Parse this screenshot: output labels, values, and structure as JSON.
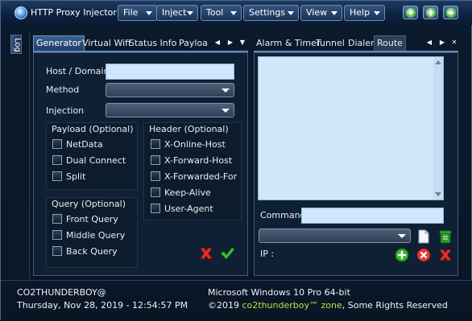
{
  "window": {
    "title": "HTTP Proxy Injector"
  },
  "menu": [
    {
      "label": "File"
    },
    {
      "label": "Inject"
    },
    {
      "label": "Tool"
    },
    {
      "label": "Settings"
    },
    {
      "label": "View"
    },
    {
      "label": "Help"
    }
  ],
  "window_buttons": {
    "icons": [
      "down-arrow-icon",
      "up-arrow-icon",
      "right-arrow-icon"
    ]
  },
  "side": {
    "log_label": "Log"
  },
  "left_tabs": {
    "items": [
      "Generator",
      "Virtual Wifi",
      "Status Info",
      "Payload"
    ],
    "active": "Generator"
  },
  "generator": {
    "host_label": "Host / Domain",
    "host_value": "",
    "method_label": "Method",
    "method_value": "",
    "injection_label": "Injection",
    "injection_value": "",
    "payload_group": {
      "title": "Payload (Optional)",
      "options": [
        "NetData",
        "Dual Connect",
        "Split"
      ]
    },
    "header_group": {
      "title": "Header (Optional)",
      "options": [
        "X-Online-Host",
        "X-Forward-Host",
        "X-Forwarded-For",
        "Keep-Alive",
        "User-Agent"
      ]
    },
    "query_group": {
      "title": "Query (Optional)",
      "options": [
        "Front Query",
        "Middle Query",
        "Back Query"
      ]
    }
  },
  "right_tabs": {
    "items": [
      "Alarm & Timer",
      "Tunnel",
      "Dialer",
      "Route"
    ],
    "active": "Route"
  },
  "route": {
    "text": "",
    "command_label": "Command",
    "command_value": "",
    "ip_label": "IP :",
    "ip_value": ""
  },
  "status": {
    "user": "CO2THUNDERBOY@",
    "datetime": "Thursday, Nov 28, 2019 - 12:54:57 PM",
    "os": "Microsoft Windows 10 Pro 64-bit",
    "copyright_prefix": "©2019",
    "brand": "co2thunderboy™ zone",
    "copyright_suffix": ", Some Rights Reserved"
  },
  "colors": {
    "accent": "#39608f",
    "brand": "#b8e04a",
    "textbox": "#cfe6fb"
  }
}
